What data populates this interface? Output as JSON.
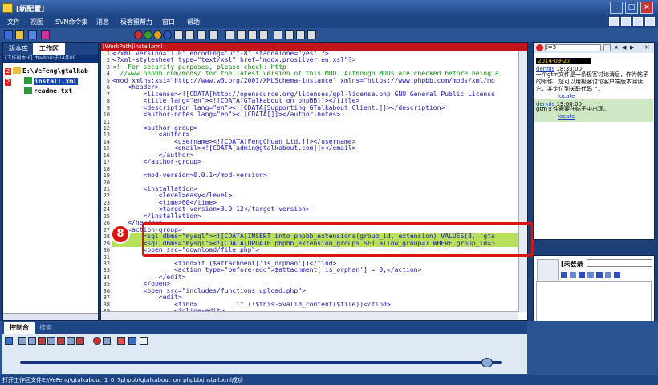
{
  "window": {
    "title": "[新配置]"
  },
  "menu": [
    "文件",
    "视图",
    "SVN命令集",
    "消息",
    "极客盟帮力",
    "窗口",
    "帮助"
  ],
  "left_panel": {
    "tabs": [
      "版本库",
      "工作区"
    ],
    "status": "[工作副本:6] 由admin于14年09",
    "tree": [
      {
        "badge": "2",
        "label": "E:\\VeFeng\\gtalkab"
      },
      {
        "badge": "2",
        "label": "install.xml",
        "selected": true
      },
      {
        "badge": "",
        "label": "readme.txt"
      }
    ]
  },
  "editor": {
    "title": "[WorkPath]install.xml",
    "lines": [
      {
        "n": 1,
        "t": "<?xml version=\"1.0\" encoding=\"utf-8\" standalone=\"yes\" ?>"
      },
      {
        "n": 2,
        "t": "<?xml-stylesheet type=\"text/xsl\" href=\"modx.prosilver.en.xsl\"?>"
      },
      {
        "n": 3,
        "t": "<!--For security purposes, please check: http",
        "c": "cmt"
      },
      {
        "n": 4,
        "t": "  //www.phpbb.com/mods/ for the latest version of this MOD. Although MODs are checked before being a",
        "c": "cmt"
      },
      {
        "n": 5,
        "t": "<mod xmlns:xsi=\"http://www.w3.org/2001/XMLSchema-instance\" xmlns=\"https://www.phpbb.com/mods/xml/mo"
      },
      {
        "n": 6,
        "t": "    <header>"
      },
      {
        "n": 7,
        "t": "        <license><![CDATA[http://opensource.org/licenses/gpl-license.php GNU General Public License"
      },
      {
        "n": 8,
        "t": "        <title lang=\"en\"><![CDATA[GTalkabout on phpBB]]></title>"
      },
      {
        "n": 9,
        "t": "        <description lang=\"en\"><![CDATA[Supporting GTalkabout Client.]]></description>"
      },
      {
        "n": 10,
        "t": "        <author-notes lang=\"en\"><![CDATA[]]></author-notes>"
      },
      {
        "n": 11,
        "t": ""
      },
      {
        "n": 12,
        "t": "        <author-group>"
      },
      {
        "n": 13,
        "t": "            <author>"
      },
      {
        "n": 14,
        "t": "                <username><![CDATA[FengChuan Ltd.]]></username>"
      },
      {
        "n": 15,
        "t": "                <email><![CDATA[admin@gtalkabout.com]]></email>"
      },
      {
        "n": 16,
        "t": "            </author>"
      },
      {
        "n": 17,
        "t": "        </author-group>"
      },
      {
        "n": 18,
        "t": ""
      },
      {
        "n": 19,
        "t": "        <mod-version>0.0.1</mod-version>"
      },
      {
        "n": 20,
        "t": ""
      },
      {
        "n": 21,
        "t": "        <installation>"
      },
      {
        "n": 22,
        "t": "            <level>easy</level>"
      },
      {
        "n": 23,
        "t": "            <time>60</time>"
      },
      {
        "n": 24,
        "t": "            <target-version>3.0.12</target-version>"
      },
      {
        "n": 25,
        "t": "        </installation>"
      },
      {
        "n": 26,
        "t": "    </header>"
      },
      {
        "n": 27,
        "t": "    <action-group>"
      },
      {
        "n": 28,
        "t": "        <sql dbms=\"mysql\"><![CDATA[INSERT into phpbb_extensions(group_id, extension) VALUES(3, 'gta"
      },
      {
        "n": 29,
        "t": "        <sql dbms=\"mysql\"><![CDATA[UPDATE phpbb_extension_groups SET allow_group=1 WHERE group_id=3"
      },
      {
        "n": 30,
        "t": "        <open src=\"download/file.php\">"
      },
      {
        "n": 31,
        "t": ""
      },
      {
        "n": 32,
        "t": "                <find>if ($attachment['is_orphan'])</find>"
      },
      {
        "n": 33,
        "t": "                <action type=\"before-add\">$attachment['is_orphan'] = 0;</action>"
      },
      {
        "n": 34,
        "t": "            </edit>"
      },
      {
        "n": 35,
        "t": "        </open>"
      },
      {
        "n": 36,
        "t": "        <open src=\"includes/functions_upload.php\">"
      },
      {
        "n": 37,
        "t": "            <edit>"
      },
      {
        "n": 38,
        "t": "                <find>          if (!$this->valid_content($file))</find>"
      },
      {
        "n": 39,
        "t": "                <inline-edit>"
      }
    ]
  },
  "callout": {
    "number": "8"
  },
  "chat": {
    "search_value": "t=3",
    "date_header": "2014-09-27",
    "messages": [
      {
        "user": "dennis",
        "time": "18:33:00：",
        "text": "一个gtm文件是一条极客讨论消息，作为帖子的附件，您可以用极客讨论客户端版本阅读它，并定位到关联代码上。",
        "link": "locate"
      },
      {
        "user": "dennis",
        "time": "19:00:00：",
        "text": "gtm文件需要在帖子中出现。",
        "link": "locate"
      }
    ],
    "login_label": "[未登录",
    "send_label": "记录",
    "reply_label": "回复"
  },
  "bottom": {
    "tabs": [
      "控制台",
      "搜索"
    ],
    "progress": 0.97
  },
  "status": "打开工作区文件E:\\VeFeng\\gtalkabout_1_0_7phpbb\\gtalkabout_on_phpbb\\install.xml成功",
  "colors": {
    "titlebar": "#1e4686",
    "highlight": "#b8e05a",
    "callout": "#d9150f",
    "editor_title": "#c3141a"
  }
}
